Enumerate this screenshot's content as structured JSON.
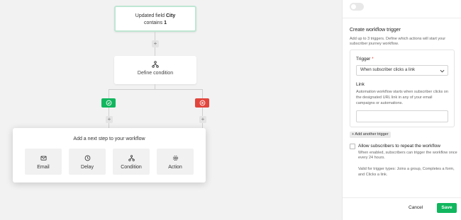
{
  "canvas": {
    "trigger_node": {
      "prefix": "Updated field",
      "field": "City",
      "operator": "contains",
      "value": "1"
    },
    "condition_node": {
      "label": "Define condition",
      "icon": "branch-icon"
    },
    "branches": {
      "yes_icon": "check-icon",
      "no_icon": "close-icon",
      "yes_color": "#11b65e",
      "no_color": "#e2453c"
    },
    "next_step": {
      "title": "Add a next step to your workflow",
      "options": [
        {
          "label": "Email",
          "icon": "mail-icon"
        },
        {
          "label": "Delay",
          "icon": "clock-icon"
        },
        {
          "label": "Condition",
          "icon": "branch-icon"
        },
        {
          "label": "Action",
          "icon": "gear-icon"
        }
      ]
    }
  },
  "side_panel": {
    "section_title": "Create workflow trigger",
    "section_desc": "Add up to 3 triggers. Define which actions will start your subscriber journey workflow.",
    "trigger_label": "Trigger",
    "trigger_required": "*",
    "trigger_value": "When subscriber clicks a link",
    "link_label": "Link",
    "link_desc": "Automation workflow starts when subscriber clicks on the designated URL link in any of your email campaigns or automations.",
    "link_value": "",
    "add_trigger": "+ Add another trigger",
    "repeat_title": "Allow subscribers to repeat the workflow",
    "repeat_desc": "When enabled, subscribers can trigger the workflow once every 24 hours.",
    "valid_desc": "Valid for trigger types: Joins a group, Completes a form, and Clicks a link.",
    "cancel_label": "Cancel",
    "save_label": "Save",
    "accent_color": "#11b65e"
  }
}
